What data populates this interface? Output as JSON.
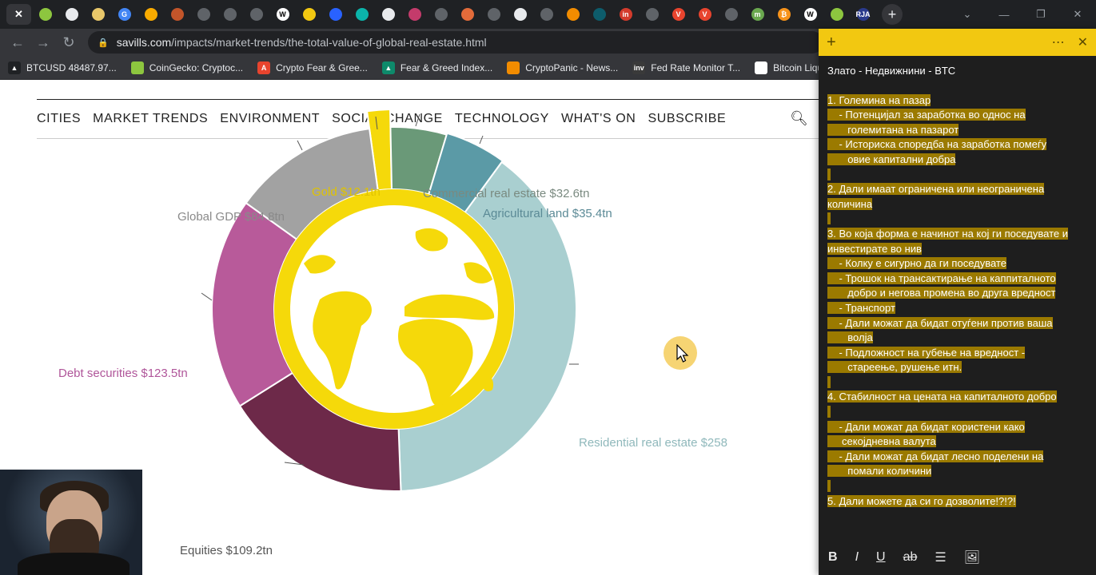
{
  "tabs": [
    {
      "icon": "close-icon",
      "glyph": "✕",
      "color": "#35363a",
      "active": true
    },
    {
      "icon": "coingecko-icon",
      "glyph": "",
      "color": "#8dc63f"
    },
    {
      "icon": "printer-icon",
      "glyph": "",
      "color": "#e8eaed"
    },
    {
      "icon": "columns-icon",
      "glyph": "",
      "color": "#e8c76a"
    },
    {
      "icon": "google-icon",
      "glyph": "G",
      "color": "#4285f4"
    },
    {
      "icon": "analytics-icon",
      "glyph": "",
      "color": "#f9ab00"
    },
    {
      "icon": "spinner-icon",
      "glyph": "",
      "color": "#c2552a"
    },
    {
      "icon": "globe-icon",
      "glyph": "",
      "color": "#5f6368"
    },
    {
      "icon": "globe-icon",
      "glyph": "",
      "color": "#5f6368"
    },
    {
      "icon": "globe-icon",
      "glyph": "",
      "color": "#5f6368"
    },
    {
      "icon": "wikipedia-icon",
      "glyph": "W",
      "color": "#ffffff"
    },
    {
      "icon": "book-icon",
      "glyph": "",
      "color": "#f2c811"
    },
    {
      "icon": "chart-icon",
      "glyph": "",
      "color": "#2962ff"
    },
    {
      "icon": "stack-icon",
      "glyph": "",
      "color": "#0bb4aa"
    },
    {
      "icon": "tradingview-icon",
      "glyph": "",
      "color": "#e8eaed"
    },
    {
      "icon": "chart-window-icon",
      "glyph": "",
      "color": "#c43b6b"
    },
    {
      "icon": "globe-icon",
      "glyph": "",
      "color": "#5f6368"
    },
    {
      "icon": "nbc-icon",
      "glyph": "",
      "color": "#e26b3a"
    },
    {
      "icon": "globe-icon",
      "glyph": "",
      "color": "#5f6368"
    },
    {
      "icon": "tradingview-icon",
      "glyph": "",
      "color": "#e8eaed"
    },
    {
      "icon": "globe-icon",
      "glyph": "",
      "color": "#5f6368"
    },
    {
      "icon": "tpm-icon",
      "glyph": "",
      "color": "#f28c00"
    },
    {
      "icon": "trend-icon",
      "glyph": "",
      "color": "#0d5c6b"
    },
    {
      "icon": "investing-icon",
      "glyph": "in",
      "color": "#d33b2c"
    },
    {
      "icon": "globe-icon",
      "glyph": "",
      "color": "#5f6368"
    },
    {
      "icon": "shield-v-icon",
      "glyph": "V",
      "color": "#e8442e"
    },
    {
      "icon": "shield-v-icon",
      "glyph": "V",
      "color": "#e8442e"
    },
    {
      "icon": "globe-icon",
      "glyph": "",
      "color": "#5f6368"
    },
    {
      "icon": "m-icon",
      "glyph": "m",
      "color": "#6aa84f"
    },
    {
      "icon": "bitcoin-icon",
      "glyph": "₿",
      "color": "#f7931a"
    },
    {
      "icon": "wikipedia-icon",
      "glyph": "W",
      "color": "#ffffff"
    },
    {
      "icon": "coingecko-icon",
      "glyph": "",
      "color": "#8dc63f"
    },
    {
      "icon": "rja-icon",
      "glyph": "RJA",
      "color": "#2a3a8c"
    }
  ],
  "window": {
    "minimize": "—",
    "maximize": "❐",
    "close": "✕",
    "tab_dropdown": "⌄"
  },
  "address": {
    "domain": "savills.com",
    "path": "/impacts/market-trends/the-total-value-of-global-real-estate.html"
  },
  "bookmarks": [
    {
      "label": "BTCUSD 48487.97...",
      "color": "#1f2124",
      "glyph": "▲",
      "icon": "tradingview-icon"
    },
    {
      "label": "CoinGecko: Cryptoc...",
      "color": "#8dc63f",
      "glyph": "",
      "icon": "coingecko-icon"
    },
    {
      "label": "Crypto Fear & Gree...",
      "color": "#e8442e",
      "glyph": "A",
      "icon": "alternative-me-icon"
    },
    {
      "label": "Fear & Greed Index...",
      "color": "#0e8a6b",
      "glyph": "▲",
      "icon": "triangle-icon"
    },
    {
      "label": "CryptoPanic - News...",
      "color": "#f28c00",
      "glyph": "",
      "icon": "cryptopanic-icon"
    },
    {
      "label": "Fed Rate Monitor T...",
      "color": "#3a3a3a",
      "glyph": "inv",
      "icon": "investing-icon"
    },
    {
      "label": "Bitcoin Liquida",
      "color": "#ffffff",
      "glyph": "",
      "icon": "liquidation-icon"
    }
  ],
  "sitenav": [
    "CITIES",
    "MARKET TRENDS",
    "ENVIRONMENT",
    "SOCIAL CHANGE",
    "TECHNOLOGY",
    "WHAT'S ON",
    "SUBSCRIBE"
  ],
  "chart_data": {
    "type": "pie",
    "title": "",
    "categories": [
      "Gold",
      "Commercial real estate",
      "Agricultural land",
      "Residential real estate",
      "Equities",
      "Debt securities",
      "Global GDP"
    ],
    "labels": [
      "Gold $12.1tn",
      "Commercial real estate $32.6tn",
      "Agricultural land $35.4tn",
      "Residential real estate $258",
      "Equities $109.2tn",
      "Debt securities $123.5tn",
      "Global GDP $84.8tn"
    ],
    "values": [
      12.1,
      32.6,
      35.4,
      258,
      109.2,
      123.5,
      84.8
    ],
    "unit": "$tn",
    "colors": [
      "#f5d90a",
      "#6a9978",
      "#5b9aa6",
      "#a9cfd0",
      "#6d2949",
      "#b85a9a",
      "#a2a2a2"
    ],
    "label_colors": [
      "#e0c300",
      "#7a8a80",
      "#5b8a96",
      "#8fb8bb",
      "#555555",
      "#b0569a",
      "#8a8a8a"
    ],
    "legend": "labels around the chart",
    "center_graphic": "globe"
  },
  "note": {
    "title": "Злато - Недвижнини - BTC",
    "lines": [
      "1. Големина на пазар",
      "    - Потенцијал за заработка во однос на",
      "       големитана на пазарот",
      "    - Историска споредба на заработка помеѓу",
      "       овие капитални добра",
      " ",
      "2. Дали имаат ограничена или неограничена",
      "количина",
      " ",
      "3. Во која форма е начинот на кој ги поседувате и",
      "инвестирате во нив",
      "    - Колку е сигурно да ги поседувате",
      "    - Трошок на трансактирање на каппиталното",
      "       добро и негова промена во друга вредност",
      "    - Транспорт",
      "    - Дали можат да бидат отуѓени против ваша",
      "       волја",
      "    - Подложност на губење на вредност -",
      "       стареење, рушење итн.",
      " ",
      "4. Стабилност на цената на капиталното добро",
      " ",
      "    - Дали можат да бидат користени како",
      "     секојдневна валута",
      "    - Дали можат да бидат лесно поделени на",
      "       помали количини",
      " ",
      "5. Дали можете да си го дозволите!?!?!"
    ],
    "toolbar": [
      "B",
      "I",
      "U",
      "ab",
      "☰",
      "🖼"
    ]
  }
}
